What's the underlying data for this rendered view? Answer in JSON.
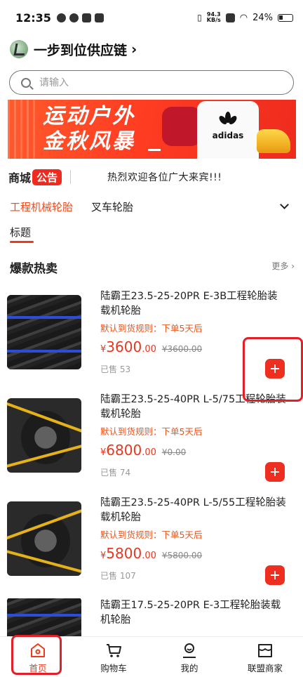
{
  "status_bar": {
    "time": "12:35",
    "net_speed_value": "94.3",
    "net_speed_unit": "KB/s",
    "battery": "24%"
  },
  "header": {
    "shop_name": "一步到位供应链",
    "chevron": "›"
  },
  "search": {
    "placeholder": "请输入"
  },
  "banner": {
    "line1": "运动户外",
    "line2": "金秋风暴",
    "brand": "adidas"
  },
  "notice": {
    "mall": "商城",
    "badge": "公告",
    "text": "热烈欢迎各位广大来宾!!!"
  },
  "categories": {
    "items": [
      "工程机械轮胎",
      "叉车轮胎"
    ],
    "active_index": 0
  },
  "subtab": {
    "label": "标题"
  },
  "section": {
    "title": "爆款热卖",
    "more": "更多 ›"
  },
  "products": [
    {
      "name": "陆霸王23.5-25-20PR E-3B工程轮胎装载机轮胎",
      "rule": "默认到货规则：下单5天后",
      "currency": "¥",
      "price_int": "3600",
      "price_dec": ".00",
      "original_price": "¥3600.00",
      "sold": "已售 53",
      "band_color": "#2a4fd6"
    },
    {
      "name": "陆霸王23.5-25-40PR L-5/75工程轮胎装载机轮胎",
      "rule": "默认到货规则：下单5天后",
      "currency": "¥",
      "price_int": "6800",
      "price_dec": ".00",
      "original_price": "¥0.00",
      "sold": "已售 74",
      "band_color": "#e6b21a"
    },
    {
      "name": "陆霸王23.5-25-40PR L-5/55工程轮胎装载机轮胎",
      "rule": "默认到货规则：下单5天后",
      "currency": "¥",
      "price_int": "5800",
      "price_dec": ".00",
      "original_price": "¥5800.00",
      "sold": "已售 107",
      "band_color": "#e6b21a"
    },
    {
      "name": "陆霸王17.5-25-20PR E-3工程轮胎装载机轮胎",
      "rule": "",
      "currency": "",
      "price_int": "",
      "price_dec": "",
      "original_price": "",
      "sold": "",
      "band_color": "#2a4fd6"
    }
  ],
  "bottom_nav": {
    "items": [
      {
        "label": "首页",
        "icon": "home-icon"
      },
      {
        "label": "购物车",
        "icon": "cart-icon"
      },
      {
        "label": "我的",
        "icon": "user-icon"
      },
      {
        "label": "联盟商家",
        "icon": "store-icon"
      }
    ],
    "active_index": 0
  },
  "colors": {
    "accent": "#ee3a1b",
    "price": "#e8361f",
    "highlight": "#e3202a"
  }
}
